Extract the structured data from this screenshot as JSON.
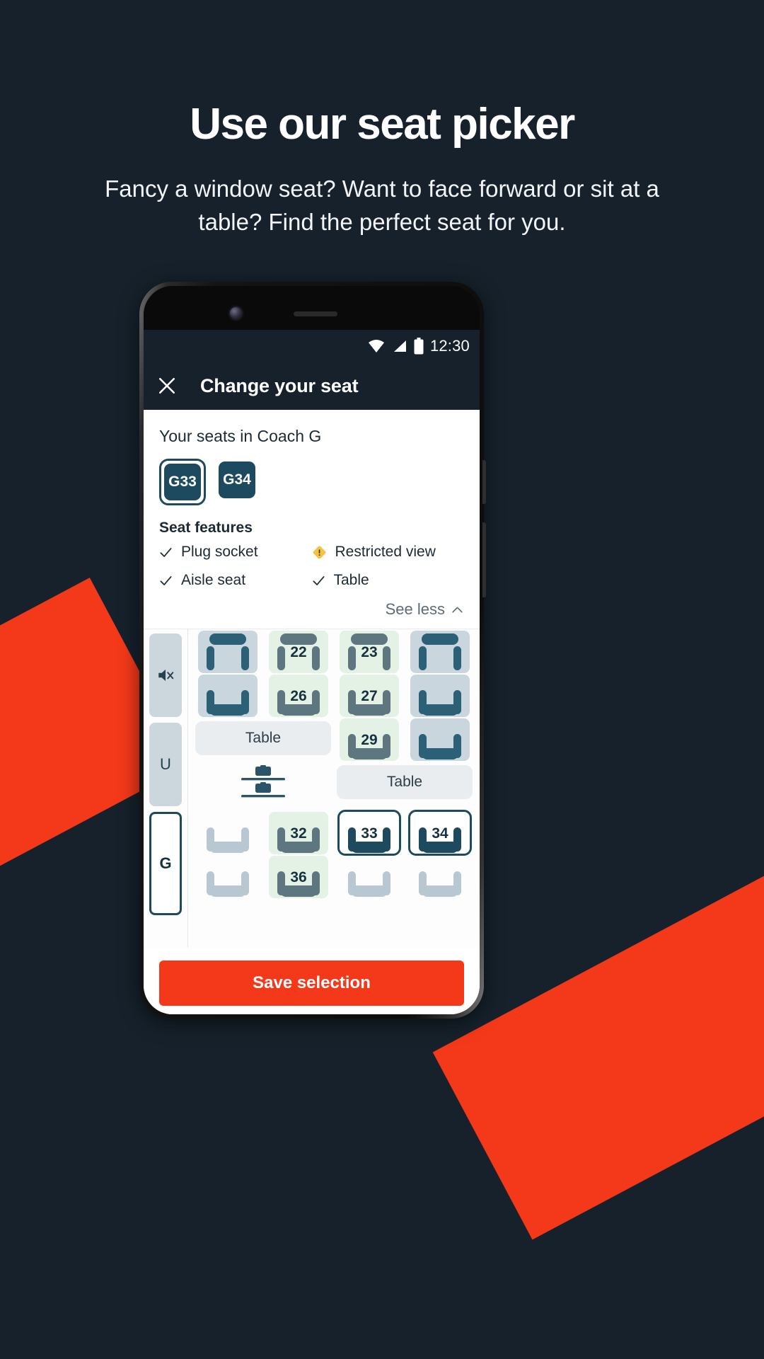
{
  "page": {
    "background_color": "#16212b",
    "accent_color": "#f4391a",
    "brand_dark": "#1e4a5f"
  },
  "hero": {
    "title": "Use our seat picker",
    "subtitle": "Fancy a window seat? Want to face forward or sit at a table? Find the perfect seat for you."
  },
  "phone": {
    "statusbar": {
      "time": "12:30",
      "icons": [
        "wifi-icon",
        "cellular-signal-icon",
        "battery-icon"
      ]
    },
    "navbar": {
      "back": "back-triangle-icon",
      "home": "home-circle-icon",
      "recents": "recents-square-icon"
    }
  },
  "app": {
    "header": {
      "close_icon": "close-icon",
      "title": "Change your seat"
    },
    "info_card": {
      "coach_heading": "Your seats in Coach G",
      "seats": [
        {
          "label": "G33",
          "selected": true
        },
        {
          "label": "G34",
          "selected": false
        }
      ],
      "features_title": "Seat features",
      "features": [
        {
          "label": "Plug socket",
          "icon": "check-icon"
        },
        {
          "label": "Restricted view",
          "icon": "warning-diamond-icon"
        },
        {
          "label": "Aisle seat",
          "icon": "check-icon"
        },
        {
          "label": "Table",
          "icon": "check-icon"
        }
      ],
      "see_less_label": "See less",
      "see_less_icon": "chevron-up-icon"
    },
    "seatmap": {
      "coaches": [
        {
          "label": "",
          "icon": "quiet-coach-icon",
          "current": false
        },
        {
          "label": "U",
          "icon": "",
          "current": false
        },
        {
          "label": "G",
          "icon": "",
          "current": true
        }
      ],
      "rows": [
        {
          "type": "seats",
          "cells": [
            {
              "kind": "seat",
              "num": "",
              "variant": "booked",
              "facing": "fwd",
              "ring": false
            },
            {
              "kind": "seat",
              "num": "22",
              "variant": "avail",
              "facing": "fwd",
              "ring": false
            },
            {
              "kind": "seat",
              "num": "23",
              "variant": "avail",
              "facing": "fwd",
              "ring": false
            },
            {
              "kind": "seat",
              "num": "",
              "variant": "booked",
              "facing": "fwd",
              "ring": false
            }
          ]
        },
        {
          "type": "seats",
          "cells": [
            {
              "kind": "seat",
              "num": "",
              "variant": "booked",
              "facing": "bwd",
              "ring": false
            },
            {
              "kind": "seat",
              "num": "26",
              "variant": "avail",
              "facing": "bwd",
              "ring": false
            },
            {
              "kind": "seat",
              "num": "27",
              "variant": "avail",
              "facing": "bwd",
              "ring": false
            },
            {
              "kind": "seat",
              "num": "",
              "variant": "booked",
              "facing": "bwd",
              "ring": false
            }
          ]
        },
        {
          "type": "mixed",
          "cells": [
            {
              "kind": "table",
              "label": "Table"
            },
            {
              "kind": "seat",
              "num": "29",
              "variant": "avail",
              "facing": "bwd",
              "ring": false
            },
            {
              "kind": "seat",
              "num": "",
              "variant": "booked",
              "facing": "bwd",
              "ring": false
            }
          ]
        },
        {
          "type": "mixed",
          "cells": [
            {
              "kind": "luggage",
              "label": "luggage-rack-icon"
            },
            {
              "kind": "table",
              "label": "Table"
            }
          ]
        },
        {
          "type": "seats",
          "cells": [
            {
              "kind": "seat",
              "num": "",
              "variant": "taken",
              "facing": "bwd",
              "ring": false
            },
            {
              "kind": "seat",
              "num": "32",
              "variant": "avail",
              "facing": "bwd",
              "ring": false
            },
            {
              "kind": "seat",
              "num": "33",
              "variant": "mine",
              "facing": "bwd",
              "ring": true
            },
            {
              "kind": "seat",
              "num": "34",
              "variant": "mine",
              "facing": "bwd",
              "ring": true
            }
          ]
        },
        {
          "type": "seats",
          "cells": [
            {
              "kind": "seat",
              "num": "",
              "variant": "taken",
              "facing": "bwd",
              "ring": false
            },
            {
              "kind": "seat",
              "num": "36",
              "variant": "avail",
              "facing": "bwd",
              "ring": false
            },
            {
              "kind": "seat",
              "num": "",
              "variant": "taken",
              "facing": "bwd",
              "ring": false
            },
            {
              "kind": "seat",
              "num": "",
              "variant": "taken",
              "facing": "bwd",
              "ring": false
            }
          ]
        }
      ]
    },
    "save_button_label": "Save selection"
  }
}
